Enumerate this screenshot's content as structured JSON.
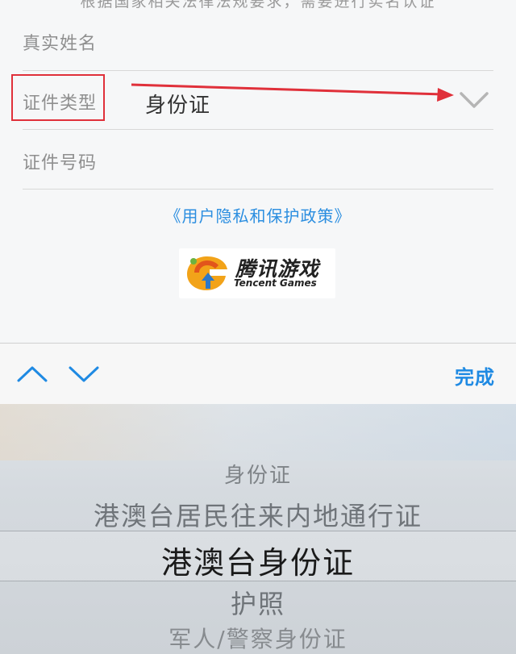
{
  "form": {
    "cut_text": "根据国家相关法律法规要求，需要进行实名认证",
    "real_name_label": "真实姓名",
    "id_type_label": "证件类型",
    "id_type_value": "身份证",
    "id_number_label": "证件号码",
    "policy_link": "《用户隐私和保护政策》"
  },
  "logo": {
    "cn": "腾讯游戏",
    "en": "Tencent Games"
  },
  "toolbar": {
    "done_label": "完成"
  },
  "picker": {
    "options": [
      "身份证",
      "港澳台居民往来内地通行证",
      "港澳台身份证",
      "护照",
      "军人/警察身份证"
    ],
    "selected_index": 2
  },
  "colors": {
    "accent": "#1f8ae3",
    "annotation": "#e0303a"
  }
}
